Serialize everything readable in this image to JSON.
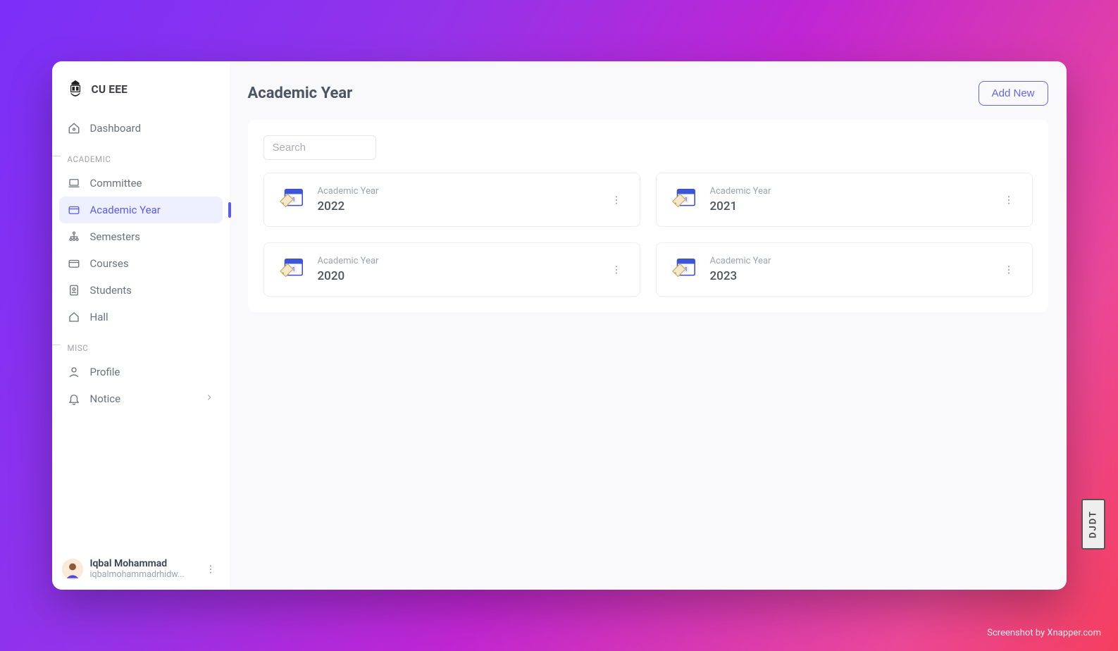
{
  "brand": {
    "title": "CU EEE"
  },
  "nav": {
    "dashboard": "Dashboard",
    "section_academic": "ACADEMIC",
    "committee": "Committee",
    "academic_year": "Academic Year",
    "semesters": "Semesters",
    "courses": "Courses",
    "students": "Students",
    "hall": "Hall",
    "section_misc": "MISC",
    "profile": "Profile",
    "notice": "Notice"
  },
  "user": {
    "name": "Iqbal Mohammad",
    "email": "iqbalmohammadrhidw..."
  },
  "page": {
    "title": "Academic Year",
    "add_button": "Add New",
    "search_placeholder": "Search"
  },
  "cards": [
    {
      "label": "Academic Year",
      "value": "2022"
    },
    {
      "label": "Academic Year",
      "value": "2021"
    },
    {
      "label": "Academic Year",
      "value": "2020"
    },
    {
      "label": "Academic Year",
      "value": "2023"
    }
  ],
  "debug": {
    "djdt": "DJDT"
  },
  "watermark": "Screenshot by Xnapper.com"
}
